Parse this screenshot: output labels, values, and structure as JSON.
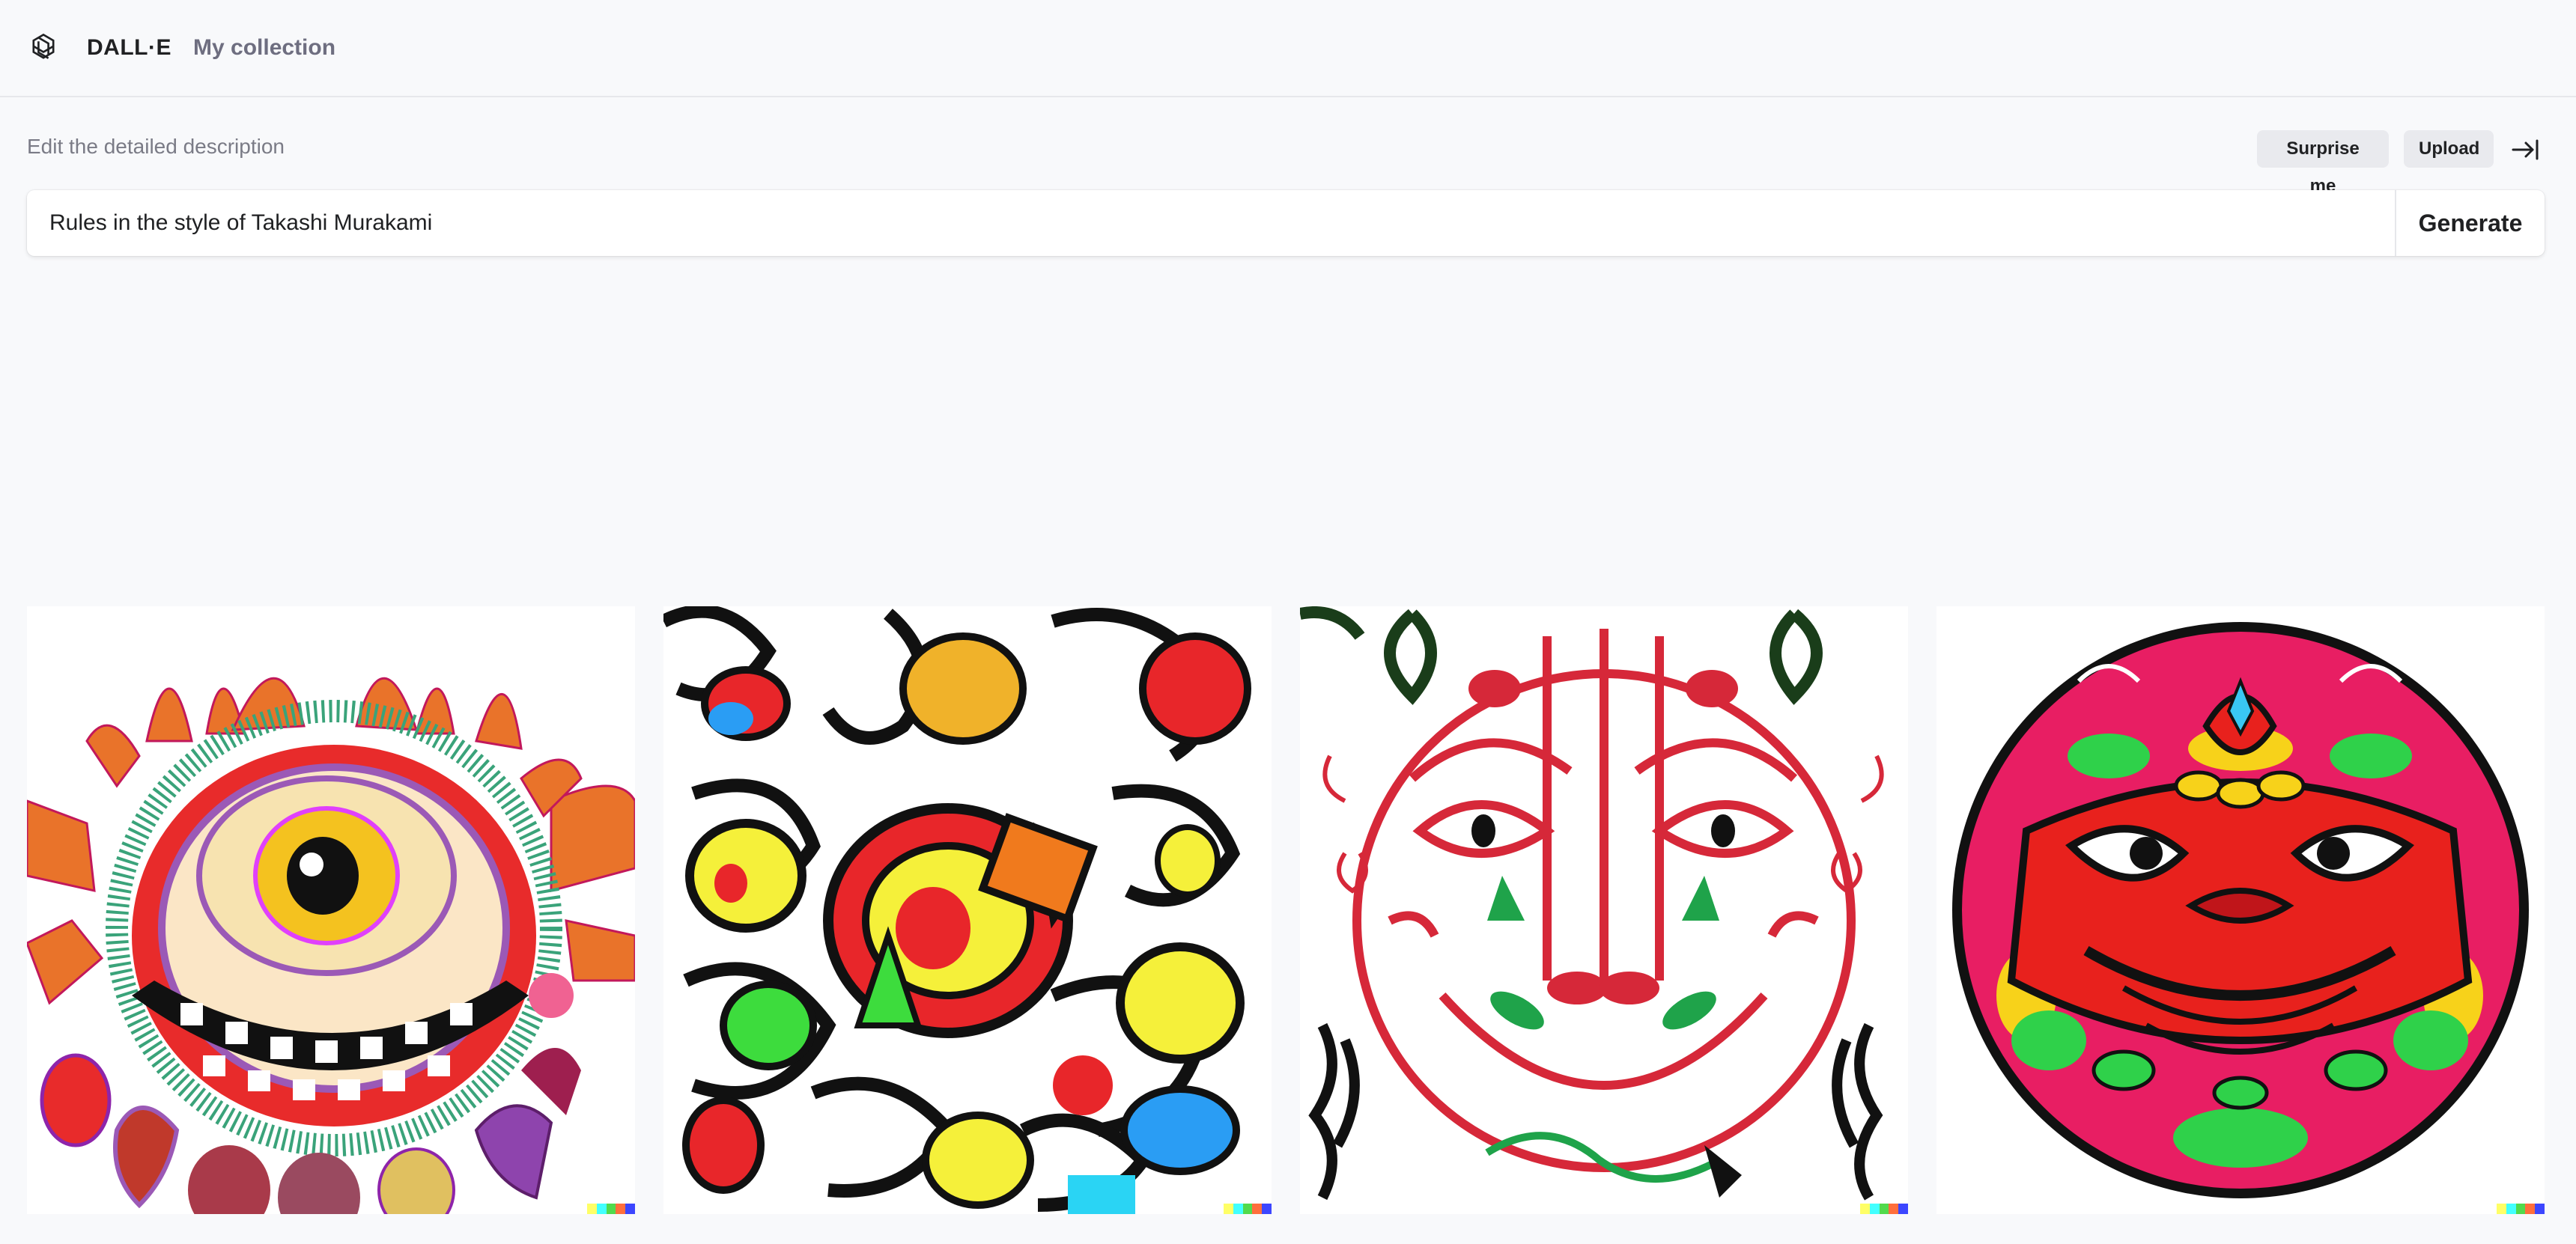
{
  "header": {
    "brand_title": "DALL·E",
    "nav_collection": "My collection",
    "logo_icon": "openai-logo-icon"
  },
  "prompt": {
    "label": "Edit the detailed description",
    "value": "Rules in the style of Takashi Murakami",
    "surprise_label": "Surprise me",
    "upload_label": "Upload",
    "generate_label": "Generate",
    "collapse_icon": "collapse-right-icon"
  },
  "results": {
    "images": [
      {
        "description_icon": "one-eyed-sun-monster-image"
      },
      {
        "description_icon": "colorful-faces-pattern-image"
      },
      {
        "description_icon": "red-line-mask-face-image"
      },
      {
        "description_icon": "red-demon-circle-image"
      }
    ],
    "watermark_colors": [
      "#ffff66",
      "#42ffff",
      "#51da4c",
      "#ff6e3c",
      "#3c46ff"
    ]
  },
  "colors": {
    "background": "#f8f9fb",
    "text_primary": "#202123",
    "text_muted": "#6e6e80",
    "button_bg": "#e9eaee"
  }
}
